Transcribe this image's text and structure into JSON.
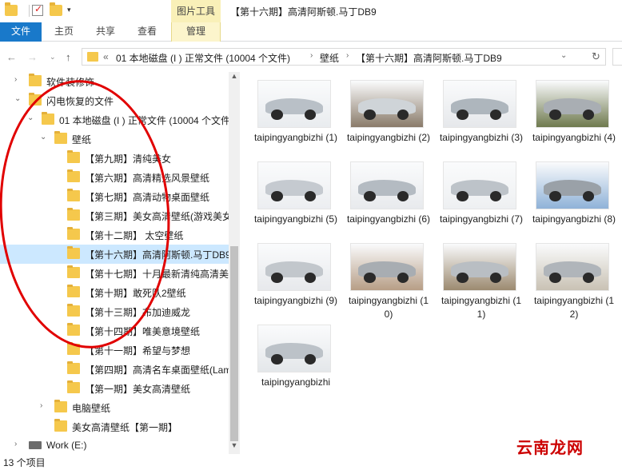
{
  "window": {
    "title": "【第十六期】高清阿斯顿.马丁DB9",
    "context_tab_group": "图片工具"
  },
  "ribbon": {
    "tabs": [
      "文件",
      "主页",
      "共享",
      "查看",
      "管理"
    ]
  },
  "address": {
    "overflow": "«",
    "segments": [
      "01 本地磁盘 (I ) 正常文件 (10004 个文件)",
      "壁纸",
      "【第十六期】高清阿斯顿.马丁DB9"
    ]
  },
  "nav_tree": [
    {
      "label": "软件装修饰",
      "depth": 0,
      "arrow": "›",
      "type": "folder"
    },
    {
      "label": "闪电恢复的文件",
      "depth": 0,
      "arrow": "⌄",
      "type": "folder"
    },
    {
      "label": "01 本地磁盘 (I ) 正常文件 (10004 个文件",
      "depth": 1,
      "arrow": "⌄",
      "type": "folder"
    },
    {
      "label": "壁纸",
      "depth": 2,
      "arrow": "⌄",
      "type": "folder"
    },
    {
      "label": "【第九期】清纯美女",
      "depth": 3,
      "arrow": "",
      "type": "folder"
    },
    {
      "label": "【第六期】高清精选风景壁纸",
      "depth": 3,
      "arrow": "",
      "type": "folder"
    },
    {
      "label": "【第七期】高清动物桌面壁纸",
      "depth": 3,
      "arrow": "",
      "type": "folder"
    },
    {
      "label": "【第三期】美女高清壁纸(游戏美女专辑",
      "depth": 3,
      "arrow": "",
      "type": "folder"
    },
    {
      "label": "【第十二期】 太空壁纸",
      "depth": 3,
      "arrow": "",
      "type": "folder"
    },
    {
      "label": "【第十六期】高清阿斯顿.马丁DB9",
      "depth": 3,
      "arrow": "",
      "type": "folder",
      "selected": true
    },
    {
      "label": "【第十七期】十月最新清纯高清美女壁",
      "depth": 3,
      "arrow": "",
      "type": "folder"
    },
    {
      "label": "【第十期】敢死队2壁纸",
      "depth": 3,
      "arrow": "",
      "type": "folder"
    },
    {
      "label": "【第十三期】布加迪威龙",
      "depth": 3,
      "arrow": "",
      "type": "folder"
    },
    {
      "label": "【第十四期】唯美意境壁纸",
      "depth": 3,
      "arrow": "",
      "type": "folder"
    },
    {
      "label": "【第十一期】希望与梦想",
      "depth": 3,
      "arrow": "",
      "type": "folder"
    },
    {
      "label": "【第四期】高清名车桌面壁纸(Lambo",
      "depth": 3,
      "arrow": "",
      "type": "folder"
    },
    {
      "label": "【第一期】美女高清壁纸",
      "depth": 3,
      "arrow": "",
      "type": "folder"
    },
    {
      "label": "电脑壁纸",
      "depth": 2,
      "arrow": "›",
      "type": "folder"
    },
    {
      "label": "美女高清壁纸【第一期】",
      "depth": 2,
      "arrow": "",
      "type": "folder"
    },
    {
      "label": "Work (E:)",
      "depth": 0,
      "arrow": "›",
      "type": "drive"
    }
  ],
  "files": [
    {
      "name": "taipingyangbizhi (1)",
      "bg": "#e9ecef",
      "car": "#b9c0c7"
    },
    {
      "name": "taipingyangbizhi (2)",
      "bg": "#8a7b6a",
      "car": "#cfd4d8"
    },
    {
      "name": "taipingyangbizhi (3)",
      "bg": "#e6e8eb",
      "car": "#aeb6bd"
    },
    {
      "name": "taipingyangbizhi (4)",
      "bg": "#6f7a4e",
      "car": "#a9aeb3"
    },
    {
      "name": "taipingyangbizhi (5)",
      "bg": "#eceef1",
      "car": "#c5cad0"
    },
    {
      "name": "taipingyangbizhi (6)",
      "bg": "#e8eaed",
      "car": "#b4bbc2"
    },
    {
      "name": "taipingyangbizhi (7)",
      "bg": "#eef0f2",
      "car": "#bdc3c9"
    },
    {
      "name": "taipingyangbizhi (8)",
      "bg": "#8fb2d8",
      "car": "#9aa1a8"
    },
    {
      "name": "taipingyangbizhi (9)",
      "bg": "#e7e9ec",
      "car": "#c2c7cc"
    },
    {
      "name": "taipingyangbizhi (10)",
      "bg": "#b79e86",
      "car": "#a8adb2"
    },
    {
      "name": "taipingyangbizhi (11)",
      "bg": "#9c8a70",
      "car": "#b9bec3"
    },
    {
      "name": "taipingyangbizhi (12)",
      "bg": "#c9c2b4",
      "car": "#b0b5ba"
    },
    {
      "name": "taipingyangbizhi",
      "bg": "#e4e7ea",
      "car": "#bcc2c8"
    }
  ],
  "status": {
    "count": "13 个项目"
  },
  "watermark": "云南龙网"
}
